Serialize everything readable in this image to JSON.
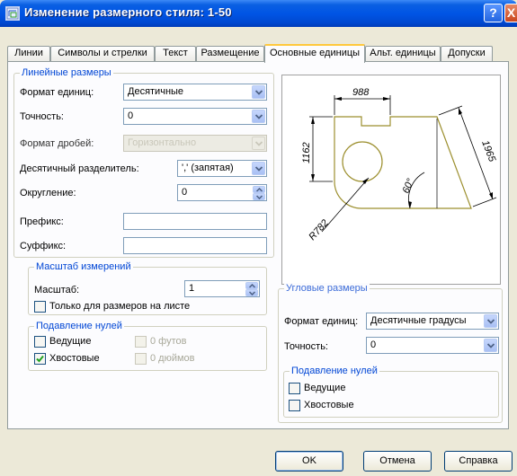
{
  "window": {
    "title": "Изменение размерного стиля: 1-50",
    "help_glyph": "?",
    "close_glyph": "X"
  },
  "tabs": [
    {
      "label": "Линии"
    },
    {
      "label": "Символы и стрелки"
    },
    {
      "label": "Текст"
    },
    {
      "label": "Размещение"
    },
    {
      "label": "Основные единицы"
    },
    {
      "label": "Альт. единицы"
    },
    {
      "label": "Допуски"
    }
  ],
  "linear": {
    "title": "Линейные размеры",
    "unit_format_label": "Формат единиц:",
    "unit_format_value": "Десятичные",
    "precision_label": "Точность:",
    "precision_value": "0",
    "fraction_format_label": "Формат дробей:",
    "fraction_format_value": "Горизонтально",
    "decimal_sep_label": "Десятичный разделитель:",
    "decimal_sep_value": "',' (запятая)",
    "roundoff_label": "Округление:",
    "roundoff_value": "0",
    "prefix_label": "Префикс:",
    "prefix_value": "",
    "suffix_label": "Суффикс:",
    "suffix_value": ""
  },
  "scale": {
    "title": "Масштаб измерений",
    "scale_label": "Масштаб:",
    "scale_value": "1",
    "layout_only_label": "Только для размеров на листе",
    "layout_only_checked": false
  },
  "linear_zero": {
    "title": "Подавление нулей",
    "leading_label": "Ведущие",
    "leading_checked": false,
    "trailing_label": "Хвостовые",
    "trailing_checked": true,
    "feet_label": "0 футов",
    "inches_label": "0 дюймов"
  },
  "preview": {
    "dim_top": "988",
    "dim_left": "1162",
    "dim_right": "1965",
    "dim_angle": "60°",
    "dim_radius": "R782"
  },
  "angular": {
    "title": "Угловые размеры",
    "unit_format_label": "Формат единиц:",
    "unit_format_value": "Десятичные градусы",
    "precision_label": "Точность:",
    "precision_value": "0"
  },
  "angular_zero": {
    "title": "Подавление нулей",
    "leading_label": "Ведущие",
    "leading_checked": false,
    "trailing_label": "Хвостовые",
    "trailing_checked": false
  },
  "buttons": {
    "ok": "OK",
    "cancel": "Отмена",
    "help": "Справка"
  },
  "colors": {
    "title_bar": "#0055e5",
    "group_title": "#0046d5",
    "preview_geometry": "#9c8f2e",
    "check_mark": "#21a121",
    "active_tab_highlight": "#ffc83c"
  }
}
